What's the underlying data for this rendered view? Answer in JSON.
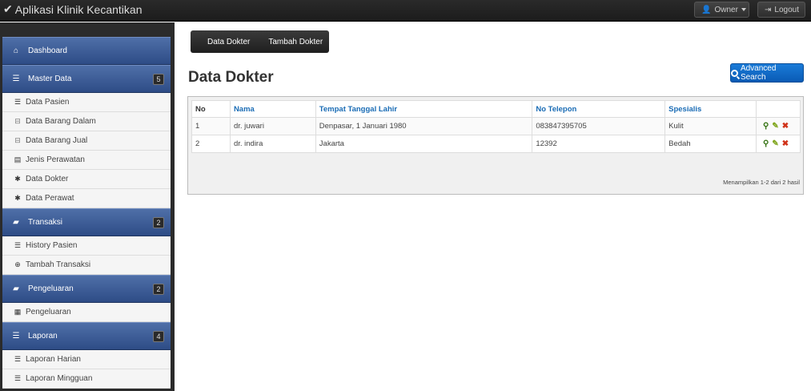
{
  "app": {
    "title": "Aplikasi Klinik Kecantikan"
  },
  "topbar": {
    "owner_label": "Owner",
    "logout_label": "Logout"
  },
  "sidebar": {
    "dashboard": {
      "label": "Dashboard",
      "icon": "home-icon"
    },
    "master": {
      "label": "Master Data",
      "badge": "5",
      "icon": "list-icon",
      "items": [
        {
          "label": "Data Pasien",
          "icon": "list-icon"
        },
        {
          "label": "Data Barang Dalam",
          "icon": "inbox-icon"
        },
        {
          "label": "Data Barang Jual",
          "icon": "inbox-icon"
        },
        {
          "label": "Jenis Perawatan",
          "icon": "card-icon"
        },
        {
          "label": "Data Dokter",
          "icon": "asterisk-icon"
        },
        {
          "label": "Data Perawat",
          "icon": "asterisk-icon"
        }
      ]
    },
    "transaksi": {
      "label": "Transaksi",
      "badge": "2",
      "icon": "briefcase-icon",
      "items": [
        {
          "label": "History Pasien",
          "icon": "list-icon"
        },
        {
          "label": "Tambah Transaksi",
          "icon": "plus-circle-icon"
        }
      ]
    },
    "pengeluaran": {
      "label": "Pengeluaran",
      "badge": "2",
      "icon": "briefcase-icon",
      "items": [
        {
          "label": "Pengeluaran",
          "icon": "grid-icon"
        }
      ]
    },
    "laporan": {
      "label": "Laporan",
      "badge": "4",
      "icon": "list-icon",
      "items": [
        {
          "label": "Laporan Harian",
          "icon": "list-icon"
        },
        {
          "label": "Laporan Mingguan",
          "icon": "list-icon"
        }
      ]
    }
  },
  "tabs": [
    {
      "label": "Data Dokter"
    },
    {
      "label": "Tambah Dokter"
    }
  ],
  "page": {
    "title": "Data Dokter",
    "advanced_search_label": "Advanced Search"
  },
  "table": {
    "columns": [
      "No",
      "Nama",
      "Tempat Tanggal Lahir",
      "No Telepon",
      "Spesialis",
      ""
    ],
    "rows": [
      {
        "no": "1",
        "nama": "dr. juwari",
        "ttl": "Denpasar, 1 Januari 1980",
        "telepon": "083847395705",
        "spesialis": "Kulit"
      },
      {
        "no": "2",
        "nama": "dr. indira",
        "ttl": "Jakarta",
        "telepon": "12392",
        "spesialis": "Bedah"
      }
    ],
    "summary": "Menampilkan 1-2 dari 2 hasil"
  },
  "colors": {
    "sidebar_head": "#3a5a98",
    "primary_button": "#0a5bb5",
    "link_header": "#1a6cb5"
  }
}
